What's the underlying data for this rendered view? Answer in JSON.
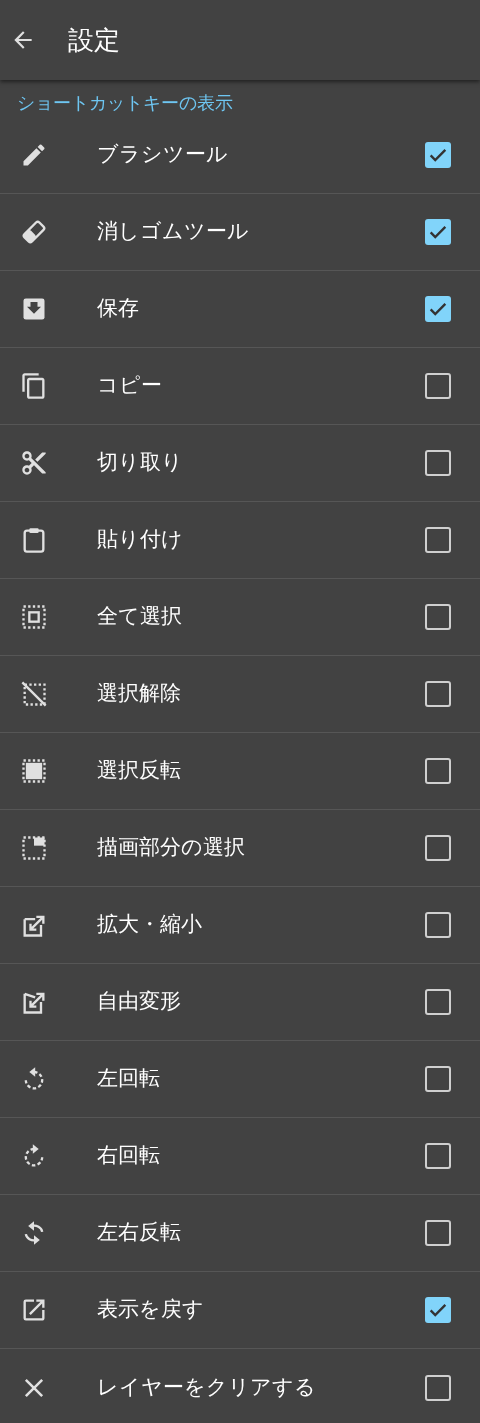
{
  "app_bar": {
    "title": "設定"
  },
  "section": {
    "title": "ショートカットキーの表示"
  },
  "items": [
    {
      "label": "ブラシツール",
      "checked": true
    },
    {
      "label": "消しゴムツール",
      "checked": true
    },
    {
      "label": "保存",
      "checked": true
    },
    {
      "label": "コピー",
      "checked": false
    },
    {
      "label": "切り取り",
      "checked": false
    },
    {
      "label": "貼り付け",
      "checked": false
    },
    {
      "label": "全て選択",
      "checked": false
    },
    {
      "label": "選択解除",
      "checked": false
    },
    {
      "label": "選択反転",
      "checked": false
    },
    {
      "label": "描画部分の選択",
      "checked": false
    },
    {
      "label": "拡大・縮小",
      "checked": false
    },
    {
      "label": "自由変形",
      "checked": false
    },
    {
      "label": "左回転",
      "checked": false
    },
    {
      "label": "右回転",
      "checked": false
    },
    {
      "label": "左右反転",
      "checked": false
    },
    {
      "label": "表示を戻す",
      "checked": true
    },
    {
      "label": "レイヤーをクリアする",
      "checked": false
    }
  ]
}
